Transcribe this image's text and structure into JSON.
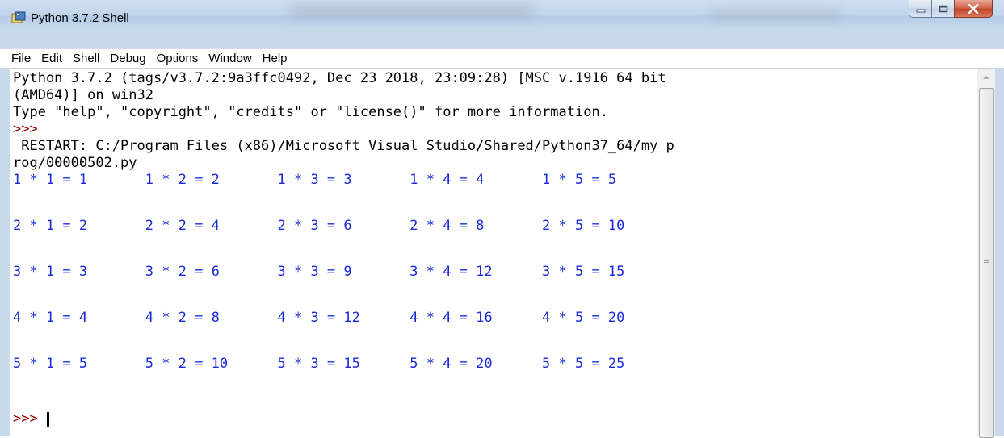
{
  "window": {
    "title": "Python 3.7.2 Shell",
    "icon": "python-shell-icon",
    "controls": [
      "minimize-icon",
      "maximize-icon",
      "close-icon"
    ]
  },
  "menu": {
    "file": "File",
    "edit": "Edit",
    "shell": "Shell",
    "debug": "Debug",
    "options": "Options",
    "window": "Window",
    "help": "Help"
  },
  "shell": {
    "banner_line1": "Python 3.7.2 (tags/v3.7.2:9a3ffc0492, Dec 23 2018, 23:09:28) [MSC v.1916 64 bit",
    "banner_line2": "(AMD64)] on win32",
    "banner_line3": "Type \"help\", \"copyright\", \"credits\" or \"license()\" for more information.",
    "prompt": ">>>",
    "restart_line1": " RESTART: C:/Program Files (x86)/Microsoft Visual Studio/Shared/Python37_64/my p",
    "restart_line2": "rog/00000502.py",
    "output_rows": [
      "1 * 1 = 1       1 * 2 = 2       1 * 3 = 3       1 * 4 = 4       1 * 5 = 5",
      "2 * 1 = 2       2 * 2 = 4       2 * 3 = 6       2 * 4 = 8       2 * 5 = 10",
      "3 * 1 = 3       3 * 2 = 6       3 * 3 = 9       3 * 4 = 12      3 * 5 = 15",
      "4 * 1 = 4       4 * 2 = 8       4 * 3 = 12      4 * 4 = 16      4 * 5 = 20",
      "5 * 1 = 5       5 * 2 = 10      5 * 3 = 15      5 * 4 = 20      5 * 5 = 25"
    ],
    "final_prompt": ">>>"
  },
  "colors": {
    "prompt": "#8b0000",
    "stdout": "#1a2bd9",
    "text": "#000000"
  }
}
